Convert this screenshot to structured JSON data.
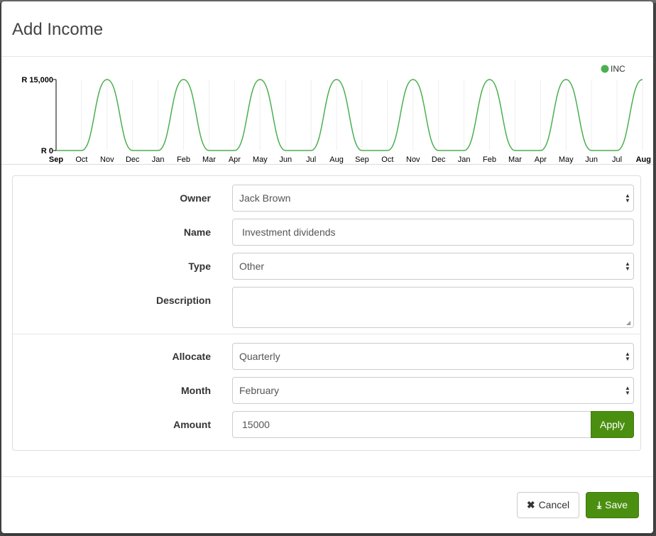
{
  "modal": {
    "title": "Add Income"
  },
  "chart_data": {
    "type": "line",
    "series": [
      {
        "name": "INC",
        "color": "#4caf50",
        "x": [
          "Sep",
          "Oct",
          "Nov",
          "Dec",
          "Jan",
          "Feb",
          "Mar",
          "Apr",
          "May",
          "Jun",
          "Jul",
          "Aug",
          "Sep",
          "Oct",
          "Nov",
          "Dec",
          "Jan",
          "Feb",
          "Mar",
          "Apr",
          "May",
          "Jun",
          "Jul",
          "Aug"
        ],
        "values": [
          0,
          0,
          15000,
          0,
          0,
          15000,
          0,
          0,
          15000,
          0,
          0,
          15000,
          0,
          0,
          15000,
          0,
          0,
          15000,
          0,
          0,
          15000,
          0,
          0,
          15000
        ]
      }
    ],
    "x_tick_labels": [
      "Sep",
      "Oct",
      "Nov",
      "Dec",
      "Jan",
      "Feb",
      "Mar",
      "Apr",
      "May",
      "Jun",
      "Jul",
      "Aug",
      "Sep",
      "Oct",
      "Nov",
      "Dec",
      "Jan",
      "Feb",
      "Mar",
      "Apr",
      "May",
      "Jun",
      "Jul",
      "Aug"
    ],
    "y_tick_labels": [
      "R 0",
      "R 15,000"
    ],
    "ylim": [
      0,
      15000
    ],
    "grid": "vertical",
    "legend_position": "top-right",
    "smooth": true
  },
  "form": {
    "owner": {
      "label": "Owner",
      "value": "Jack Brown"
    },
    "name": {
      "label": "Name",
      "value": "Investment dividends"
    },
    "type": {
      "label": "Type",
      "value": "Other"
    },
    "description": {
      "label": "Description",
      "value": ""
    },
    "allocate": {
      "label": "Allocate",
      "value": "Quarterly"
    },
    "month": {
      "label": "Month",
      "value": "February"
    },
    "amount": {
      "label": "Amount",
      "value": "15000",
      "apply_label": "Apply"
    }
  },
  "footer": {
    "cancel_label": "Cancel",
    "save_label": "Save"
  },
  "colors": {
    "primary": "#4b8f11",
    "series": "#4caf50"
  },
  "icons": {
    "cancel": "close-icon",
    "save": "download-icon",
    "select": "select-arrows-icon"
  }
}
